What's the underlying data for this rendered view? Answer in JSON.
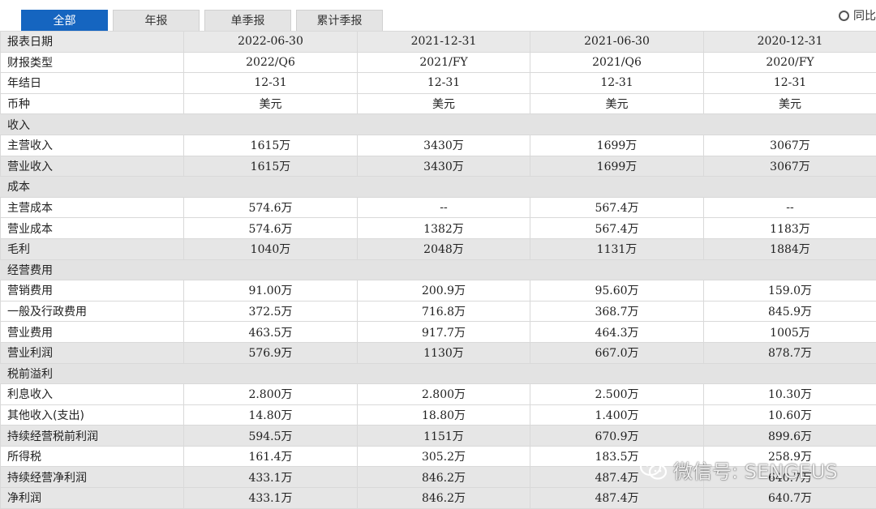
{
  "tabs": [
    {
      "label": "全部",
      "active": true
    },
    {
      "label": "年报",
      "active": false
    },
    {
      "label": "单季报",
      "active": false
    },
    {
      "label": "累计季报",
      "active": false
    }
  ],
  "yoy_toggle": {
    "label": "同比",
    "checked": false,
    "icon": "radio-icon"
  },
  "table": {
    "header_label": "报表日期",
    "columns": [
      "2022-06-30",
      "2021-12-31",
      "2021-06-30",
      "2020-12-31"
    ],
    "rows": [
      {
        "type": "plain",
        "label": "财报类型",
        "values": [
          "2022/Q6",
          "2021/FY",
          "2021/Q6",
          "2020/FY"
        ]
      },
      {
        "type": "plain",
        "label": "年结日",
        "values": [
          "12-31",
          "12-31",
          "12-31",
          "12-31"
        ]
      },
      {
        "type": "plain",
        "label": "币种",
        "values": [
          "美元",
          "美元",
          "美元",
          "美元"
        ]
      },
      {
        "type": "section",
        "label": "收入",
        "values": [
          "",
          "",
          "",
          ""
        ]
      },
      {
        "type": "plain",
        "label": "主营收入",
        "values": [
          "1615万",
          "3430万",
          "1699万",
          "3067万"
        ]
      },
      {
        "type": "hl",
        "label": "营业收入",
        "values": [
          "1615万",
          "3430万",
          "1699万",
          "3067万"
        ]
      },
      {
        "type": "section",
        "label": "成本",
        "values": [
          "",
          "",
          "",
          ""
        ]
      },
      {
        "type": "plain",
        "label": "主营成本",
        "values": [
          "574.6万",
          "--",
          "567.4万",
          "--"
        ]
      },
      {
        "type": "plain",
        "label": "营业成本",
        "values": [
          "574.6万",
          "1382万",
          "567.4万",
          "1183万"
        ]
      },
      {
        "type": "hl",
        "label": "毛利",
        "values": [
          "1040万",
          "2048万",
          "1131万",
          "1884万"
        ]
      },
      {
        "type": "section",
        "label": "经营费用",
        "values": [
          "",
          "",
          "",
          ""
        ]
      },
      {
        "type": "plain",
        "label": "营销费用",
        "values": [
          "91.00万",
          "200.9万",
          "95.60万",
          "159.0万"
        ]
      },
      {
        "type": "plain",
        "label": "一般及行政费用",
        "values": [
          "372.5万",
          "716.8万",
          "368.7万",
          "845.9万"
        ]
      },
      {
        "type": "plain",
        "label": "营业费用",
        "values": [
          "463.5万",
          "917.7万",
          "464.3万",
          "1005万"
        ]
      },
      {
        "type": "hl",
        "label": "营业利润",
        "values": [
          "576.9万",
          "1130万",
          "667.0万",
          "878.7万"
        ]
      },
      {
        "type": "section",
        "label": "税前溢利",
        "values": [
          "",
          "",
          "",
          ""
        ]
      },
      {
        "type": "plain",
        "label": "利息收入",
        "values": [
          "2.800万",
          "2.800万",
          "2.500万",
          "10.30万"
        ]
      },
      {
        "type": "plain",
        "label": "其他收入(支出)",
        "values": [
          "14.80万",
          "18.80万",
          "1.400万",
          "10.60万"
        ]
      },
      {
        "type": "hl",
        "label": "持续经营税前利润",
        "values": [
          "594.5万",
          "1151万",
          "670.9万",
          "899.6万"
        ]
      },
      {
        "type": "plain",
        "label": "所得税",
        "values": [
          "161.4万",
          "305.2万",
          "183.5万",
          "258.9万"
        ]
      },
      {
        "type": "hl",
        "label": "持续经营净利润",
        "values": [
          "433.1万",
          "846.2万",
          "487.4万",
          "640.7万"
        ]
      },
      {
        "type": "hl",
        "label": "净利润",
        "values": [
          "433.1万",
          "846.2万",
          "487.4万",
          "640.7万"
        ]
      }
    ]
  },
  "watermark": {
    "text": "微信号: SENGEUS",
    "icon": "wechat-icon"
  }
}
